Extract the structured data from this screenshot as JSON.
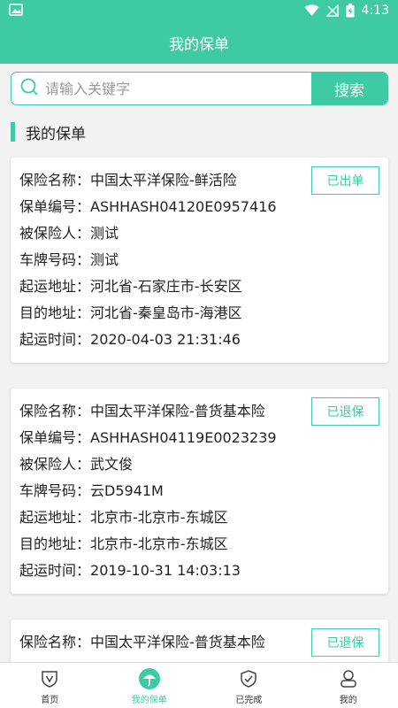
{
  "status_bar": {
    "time": "4:13"
  },
  "header": {
    "title": "我的保单"
  },
  "search": {
    "placeholder": "请输入关键字",
    "button": "搜索"
  },
  "section": {
    "title": "我的保单"
  },
  "policies": [
    {
      "name_label": "保险名称：",
      "name": "中国太平洋保险-鲜活险",
      "no_label": "保单编号：",
      "no": "ASHHASH04120E0957416",
      "insured_label": "被保险人：",
      "insured": "测试",
      "plate_label": "车牌号码：",
      "plate": "测试",
      "from_label": "起运地址：",
      "from": "河北省-石家庄市-长安区",
      "to_label": "目的地址：",
      "to": "河北省-秦皇岛市-海港区",
      "time_label": "起运时间：",
      "time": "2020-04-03 21:31:46",
      "status": "已出单"
    },
    {
      "name_label": "保险名称：",
      "name": "中国太平洋保险-普货基本险",
      "no_label": "保单编号：",
      "no": "ASHHASH04119E0023239",
      "insured_label": "被保险人：",
      "insured": "武文俊",
      "plate_label": "车牌号码：",
      "plate": "云D5941M",
      "from_label": "起运地址：",
      "from": "北京市-北京市-东城区",
      "to_label": "目的地址：",
      "to": "北京市-北京市-东城区",
      "time_label": "起运时间：",
      "time": "2019-10-31 14:03:13",
      "status": "已退保"
    },
    {
      "name_label": "保险名称：",
      "name": "中国太平洋保险-普货基本险",
      "status": "已退保"
    }
  ],
  "bottom_nav": [
    {
      "label": "首页",
      "icon": "shield-v-icon"
    },
    {
      "label": "我的保单",
      "icon": "umbrella-icon"
    },
    {
      "label": "已完成",
      "icon": "shield-check-icon"
    },
    {
      "label": "我的",
      "icon": "user-icon"
    }
  ],
  "colors": {
    "accent": "#3ecba3",
    "background": "#f2f2f2"
  }
}
